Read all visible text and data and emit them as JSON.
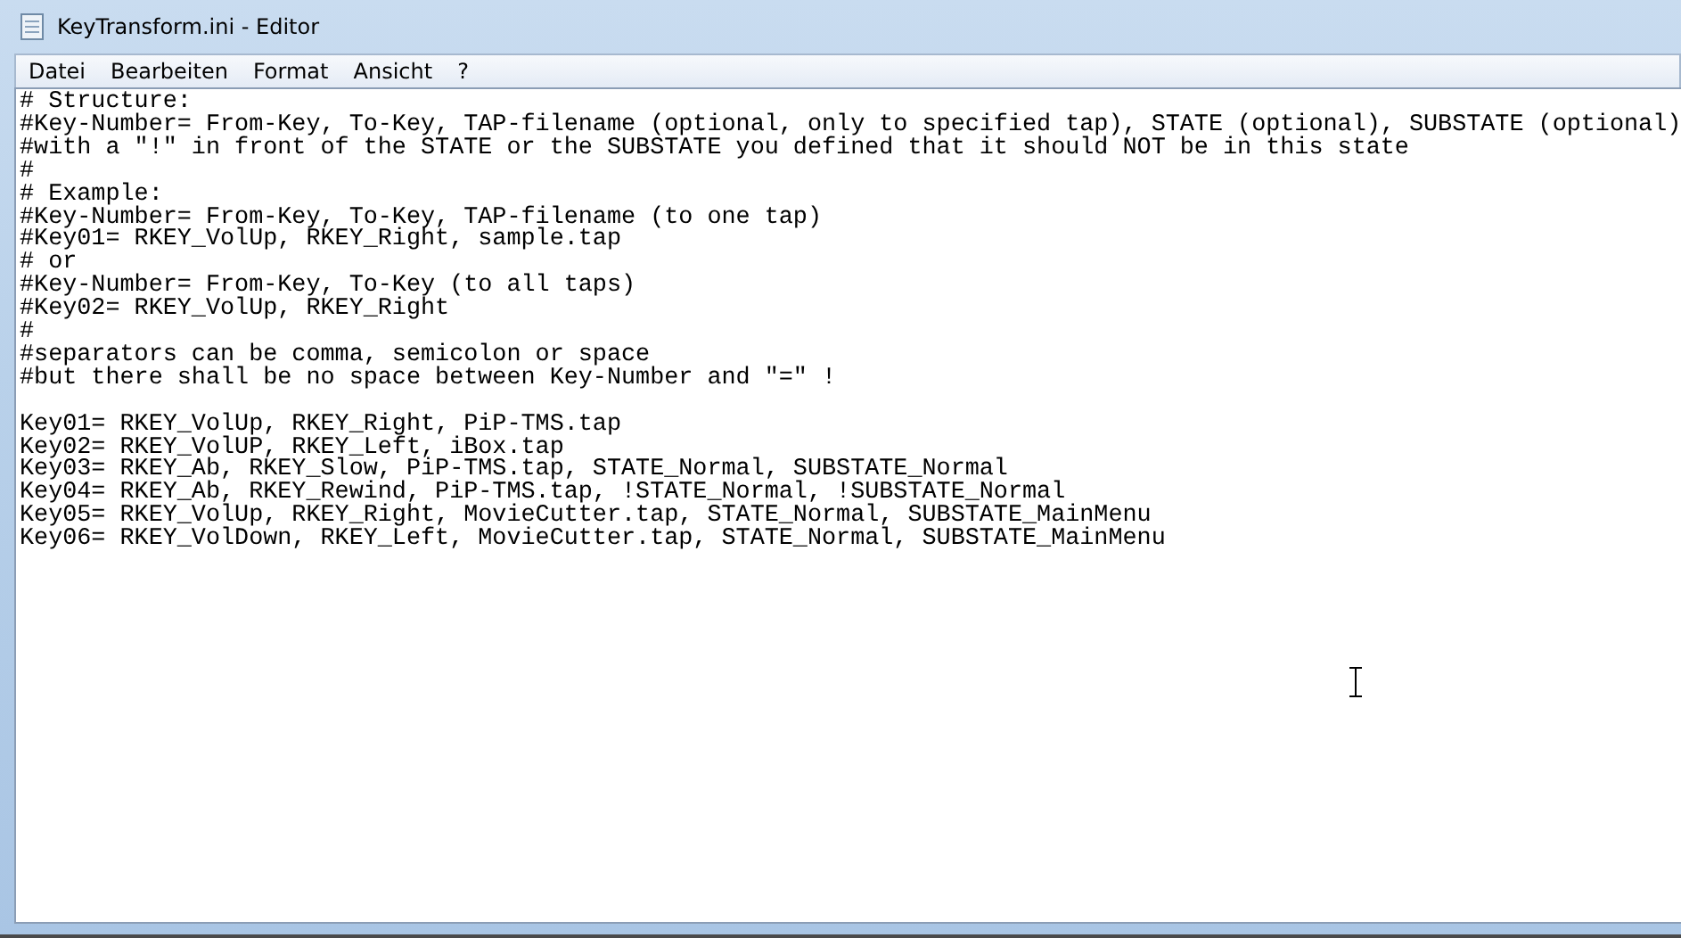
{
  "window": {
    "title": "KeyTransform.ini - Editor"
  },
  "menu": [
    {
      "label": "Datei"
    },
    {
      "label": "Bearbeiten"
    },
    {
      "label": "Format"
    },
    {
      "label": "Ansicht"
    },
    {
      "label": "?"
    }
  ],
  "editor": {
    "blocks": [
      {
        "lines": [
          "# Structure:",
          "#Key-Number= From-Key, To-Key, TAP-filename (optional, only to specified tap), STATE (optional), SUBSTATE (optional)",
          "#with a \"!\" in front of the STATE or the SUBSTATE you defined that it should NOT be in this state",
          "#",
          "# Example:",
          "#Key-Number= From-Key, To-Key, TAP-filename (to one tap)",
          "#Key01= RKEY_VolUp, RKEY_Right, sample.tap",
          "# or",
          "#Key-Number= From-Key, To-Key (to all taps)",
          "#Key02= RKEY_VolUp, RKEY_Right",
          "#",
          "#separators can be comma, semicolon or space",
          "#but there shall be no space between Key-Number and \"=\" !"
        ]
      },
      {
        "lines": [
          "Key01= RKEY_VolUp, RKEY_Right, PiP-TMS.tap",
          "Key02= RKEY_VolUP, RKEY_Left, iBox.tap",
          "Key03= RKEY_Ab, RKEY_Slow, PiP-TMS.tap, STATE_Normal, SUBSTATE_Normal",
          "Key04= RKEY_Ab, RKEY_Rewind, PiP-TMS.tap, !STATE_Normal, !SUBSTATE_Normal",
          "Key05= RKEY_VolUp, RKEY_Right, MovieCutter.tap, STATE_Normal, SUBSTATE_MainMenu",
          "Key06= RKEY_VolDown, RKEY_Left, MovieCutter.tap, STATE_Normal, SUBSTATE_MainMenu"
        ]
      }
    ]
  }
}
